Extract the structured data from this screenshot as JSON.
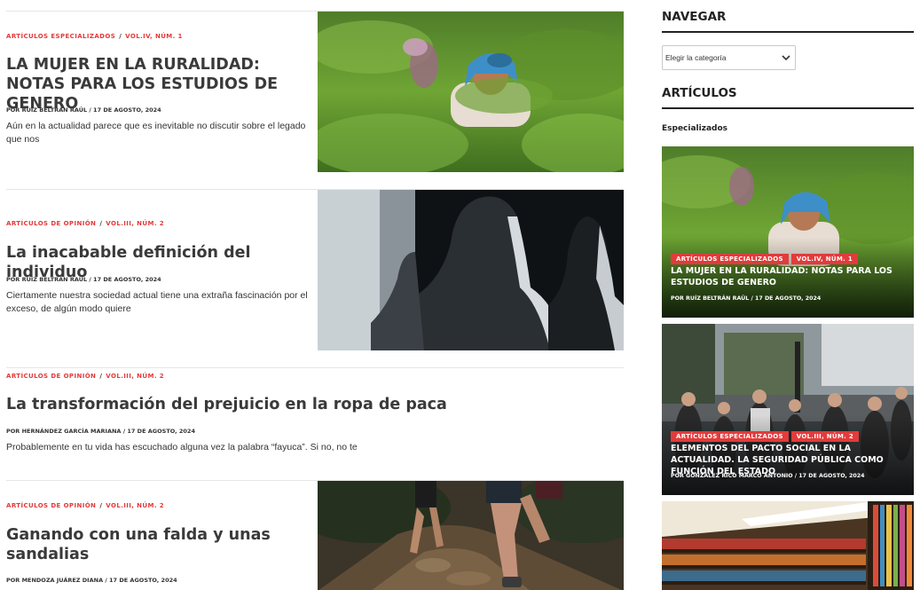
{
  "colors": {
    "accent": "#e23b3b",
    "heading": "#3a3a3a",
    "text": "#333333",
    "divider": "#e6e6e6"
  },
  "articles": [
    {
      "category": "ARTÍCULOS ESPECIALIZADOS",
      "issue": "VOL.IV, NÚM. 1",
      "title": "LA MUJER EN LA RURALIDAD: NOTAS PARA LOS ESTUDIOS DE GENERO",
      "byline_prefix": "POR",
      "author": "RUÍZ BELTRÁN RAÚL",
      "date": "17 DE AGOSTO, 2024",
      "excerpt": "Aún en la actualidad parece que es inevitable no discutir sobre el legado que nos",
      "image": "tea-field-woman-photo"
    },
    {
      "category": "ARTÍCULOS DE OPINIÓN",
      "issue": "VOL.III, NÚM. 2",
      "title": "La inacabable definición del individuo",
      "byline_prefix": "POR",
      "author": "RUÍZ BELTRÁN RAÚL",
      "date": "17 DE AGOSTO, 2024",
      "excerpt": "Ciertamente nuestra sociedad actual tiene una extraña fascinación por el exceso, de algún modo quiere",
      "image": "silhouette-heads-photo"
    },
    {
      "category": "ARTÍCULOS DE OPINIÓN",
      "issue": "VOL.III, NÚM. 2",
      "title": "La transformación del prejuicio en la ropa de paca",
      "byline_prefix": "POR",
      "author": "HERNÁNDEZ GARCÍA MARIANA",
      "date": "17 DE AGOSTO, 2024",
      "excerpt": "Probablemente en tu vida has escuchado alguna vez la palabra “fayuca”. Si no, no te",
      "image": ""
    },
    {
      "category": "ARTÍCULOS DE OPINIÓN",
      "issue": "VOL.III, NÚM. 2",
      "title": "Ganando con una falda y unas sandalias",
      "byline_prefix": "POR",
      "author": "MENDOZA JUÁREZ DIANA",
      "date": "17 DE AGOSTO, 2024",
      "excerpt": "",
      "image": "trail-runners-photo"
    }
  ],
  "sidebar": {
    "nav_heading": "NAVEGAR",
    "select_value": "Elegir la categoría",
    "articles_heading": "ARTÍCULOS",
    "sub_heading": "Especializados",
    "cards": [
      {
        "category": "ARTÍCULOS ESPECIALIZADOS",
        "issue": "VOL.IV, NÚM. 1",
        "title": "LA MUJER EN LA RURALIDAD: NOTAS PARA LOS ESTUDIOS DE GENERO",
        "byline_prefix": "POR",
        "author": "RUÍZ BELTRÁN RAÚL",
        "date": "17 DE AGOSTO, 2024",
        "image": "tea-field-woman-photo"
      },
      {
        "category": "ARTÍCULOS ESPECIALIZADOS",
        "issue": "VOL.III, NÚM. 2",
        "title": "ELEMENTOS DEL PACTO SOCIAL EN LA ACTUALIDAD. LA SEGURIDAD PÚBLICA COMO FUNCIÓN DEL ESTADO",
        "byline_prefix": "POR",
        "author": "GONZÁLEZ RICO MARCO ANTONIO",
        "date": "17 DE AGOSTO, 2024",
        "image": "city-crowd-photo"
      },
      {
        "category": "",
        "issue": "",
        "title": "",
        "byline_prefix": "",
        "author": "",
        "date": "",
        "image": "library-shelves-photo"
      }
    ]
  }
}
